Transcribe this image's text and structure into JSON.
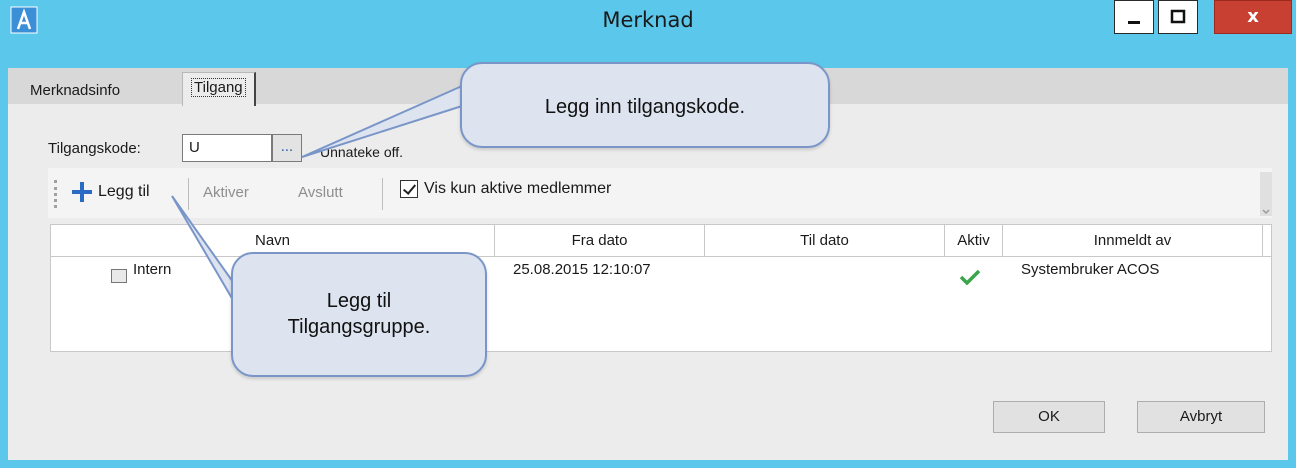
{
  "window": {
    "title": "Merknad",
    "close_label": "x"
  },
  "tabs": [
    {
      "label": "Merknadsinfo"
    },
    {
      "label": "Tilgang"
    }
  ],
  "form": {
    "kode_label": "Tilgangskode:",
    "kode_value": "U",
    "browse_label": "...",
    "kode_description": "Unnateke off."
  },
  "toolbar": {
    "add_label": "Legg til",
    "activate_label": "Aktiver",
    "end_label": "Avslutt",
    "filter_label": "Vis kun aktive medlemmer",
    "filter_checked": true
  },
  "grid": {
    "columns": [
      "Navn",
      "Fra dato",
      "Til dato",
      "Aktiv",
      "Innmeldt av"
    ],
    "rows": [
      {
        "navn": "Intern",
        "fra_dato": "25.08.2015 12:10:07",
        "til_dato": "",
        "aktiv": true,
        "innmeldt_av": "Systembruker ACOS"
      }
    ]
  },
  "buttons": {
    "ok": "OK",
    "cancel": "Avbryt"
  },
  "callouts": {
    "kode": "Legg inn tilgangskode.",
    "add_line1": "Legg til",
    "add_line2": "Tilgangsgruppe."
  },
  "colors": {
    "titlebar": "#5bc7ea",
    "close_button": "#c84031",
    "plus_icon": "#2a6ac2",
    "active_check": "#3aa54a",
    "callout_fill": "#dde4ef",
    "callout_border": "#7a96c8"
  }
}
